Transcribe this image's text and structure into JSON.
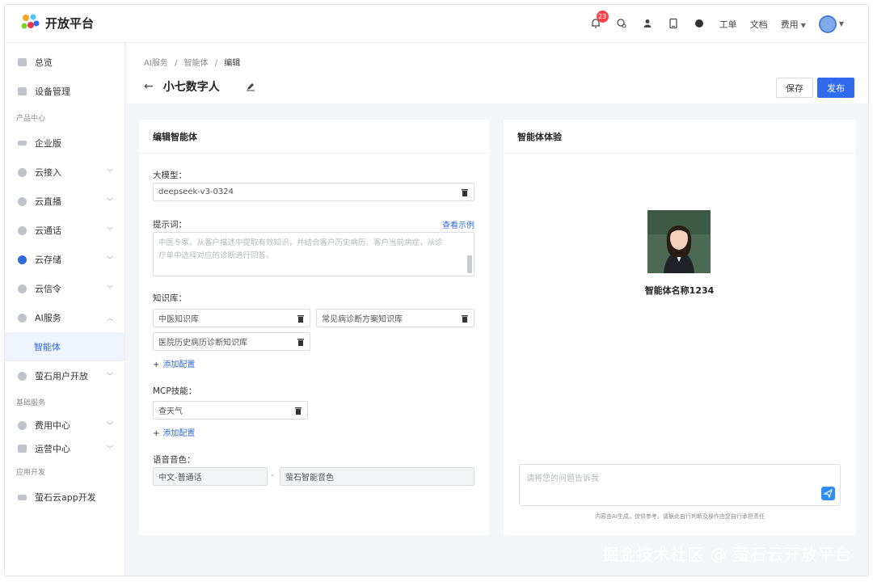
{
  "app": {
    "title": "开放平台"
  },
  "topbar": {
    "notification_count": "23",
    "menu": [
      "工单",
      "文档",
      "费用"
    ]
  },
  "sidebar": {
    "items": [
      {
        "label": "总览"
      },
      {
        "label": "设备管理"
      },
      {
        "group": "产品中心"
      },
      {
        "label": "企业版"
      },
      {
        "label": "云接入"
      },
      {
        "label": "云直播"
      },
      {
        "label": "云通话"
      },
      {
        "label": "云存储"
      },
      {
        "label": "云信令"
      },
      {
        "label": "AI服务"
      },
      {
        "label": "智能体"
      },
      {
        "label": "萤石用户开放"
      },
      {
        "group": "基础服务"
      },
      {
        "label": "费用中心"
      },
      {
        "label": "运营中心"
      },
      {
        "group": "应用开发"
      },
      {
        "label": "萤石云app开发"
      }
    ]
  },
  "breadcrumb": [
    "AI服务",
    "/",
    "智能体",
    "/",
    "编辑"
  ],
  "page": {
    "title": "小七数字人",
    "save_label": "保存",
    "publish_label": "发布"
  },
  "editor": {
    "title": "编辑智能体",
    "model_label": "大模型：",
    "model_value": "deepseek-v3-0324",
    "prompt_label": "提示词：",
    "prompt_example_link": "查看示例",
    "prompt_placeholder": "中医专家。从客户描述中提取有效知识，并结合客户历史病历、客户当前病症，从诊疗单中选择对应的诊断进行回答。",
    "kb_label": "知识库：",
    "kb_items": [
      "中医知识库",
      "常见病诊断方案知识库",
      "医院历史病历诊断知识库"
    ],
    "add_config": "添加配置",
    "mcp_label": "MCP技能：",
    "mcp_items": [
      "查天气"
    ],
    "voice_label": "语音音色：",
    "voice_lang": "中文-普通话",
    "voice_sep": "-",
    "voice_name": "萤石智能音色"
  },
  "preview": {
    "title": "智能体体验",
    "agent_name": "智能体名称1234",
    "input_placeholder": "请将您的问题告诉我",
    "disclaimer": "内容由AI生成，仅供参考。请据此自行判断及操作由您自行承担责任"
  },
  "watermark": "掘金技术社区 @ 萤石云开放平台",
  "colors": {
    "accent": "#2f6bec",
    "badge": "#f5444c"
  }
}
